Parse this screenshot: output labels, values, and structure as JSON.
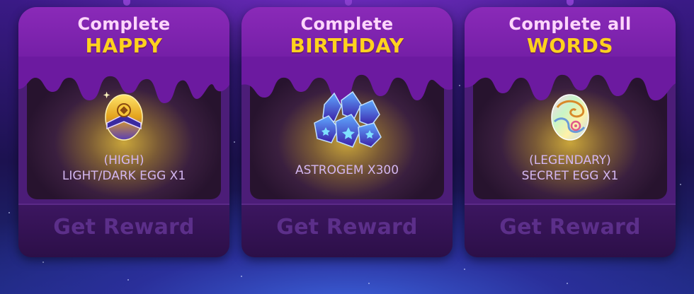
{
  "cards": [
    {
      "title_line1": "Complete",
      "title_line2": "HAPPY",
      "reward_line1": "(HIGH)",
      "reward_line2": "LIGHT/DARK EGG X1",
      "icon": "light-dark-egg-icon",
      "button_label": "Get Reward"
    },
    {
      "title_line1": "Complete",
      "title_line2": "BIRTHDAY",
      "reward_line1": "ASTROGEM X300",
      "icon": "astrogem-icon",
      "button_label": "Get Reward"
    },
    {
      "title_line1": "Complete all",
      "title_line2": "WORDS",
      "reward_line1": "(LEGENDARY)",
      "reward_line2": "SECRET EGG X1",
      "icon": "secret-egg-icon",
      "button_label": "Get Reward"
    }
  ],
  "colors": {
    "title_highlight": "#ffd21e",
    "card_purple": "#7a22ac",
    "button_text_disabled": "#5c2f8a"
  }
}
